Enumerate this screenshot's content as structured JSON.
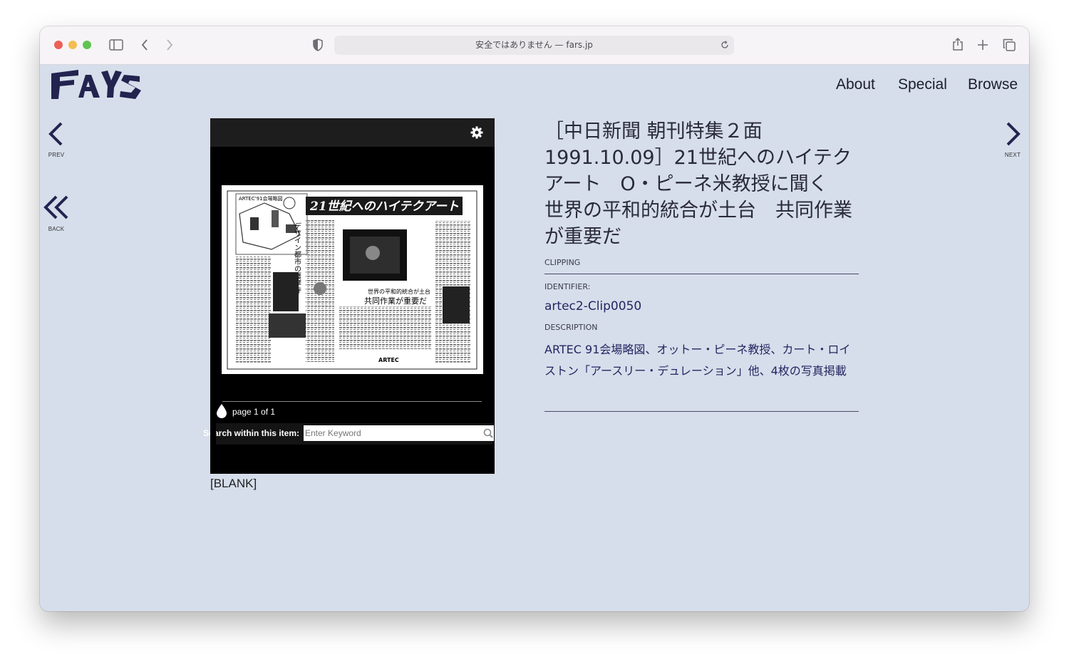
{
  "browser": {
    "url_text": "安全ではありません — fars.jp"
  },
  "site": {
    "nav": {
      "about": "About",
      "special": "Special",
      "browse": "Browse"
    },
    "side": {
      "prev": "PREV",
      "back": "BACK",
      "next": "NEXT"
    }
  },
  "viewer": {
    "page_text": "page 1 of 1",
    "search_label": "Search within this item:",
    "search_placeholder": "Enter Keyword",
    "clipping_headline": "21世紀へのハイテクアート",
    "clipping_sub1": "世界の平和的統合が土台",
    "clipping_sub2": "共同作業が重要だ",
    "clipping_tag": "ARTEC'91会場略図",
    "clipping_side": "デザイン都市の護摩寺",
    "clipping_footer": "ARTEC"
  },
  "caption": "[BLANK]",
  "record": {
    "title": "［中日新聞 朝刊特集２面 1991.10.09］21世紀へのハイテクアート　O・ピーネ米教授に聞く　世界の平和的統合が土台　共同作業 が重要だ",
    "type_label": "CLIPPING",
    "identifier_label": "IDENTIFIER:",
    "identifier_value": "artec2-Clip0050",
    "description_label": "DESCRIPTION",
    "description_value": "ARTEC 91会場略図、オットー・ピーネ教授、カート・ロイストン「アースリー・デュレーション」他、4枚の写真掲載"
  }
}
